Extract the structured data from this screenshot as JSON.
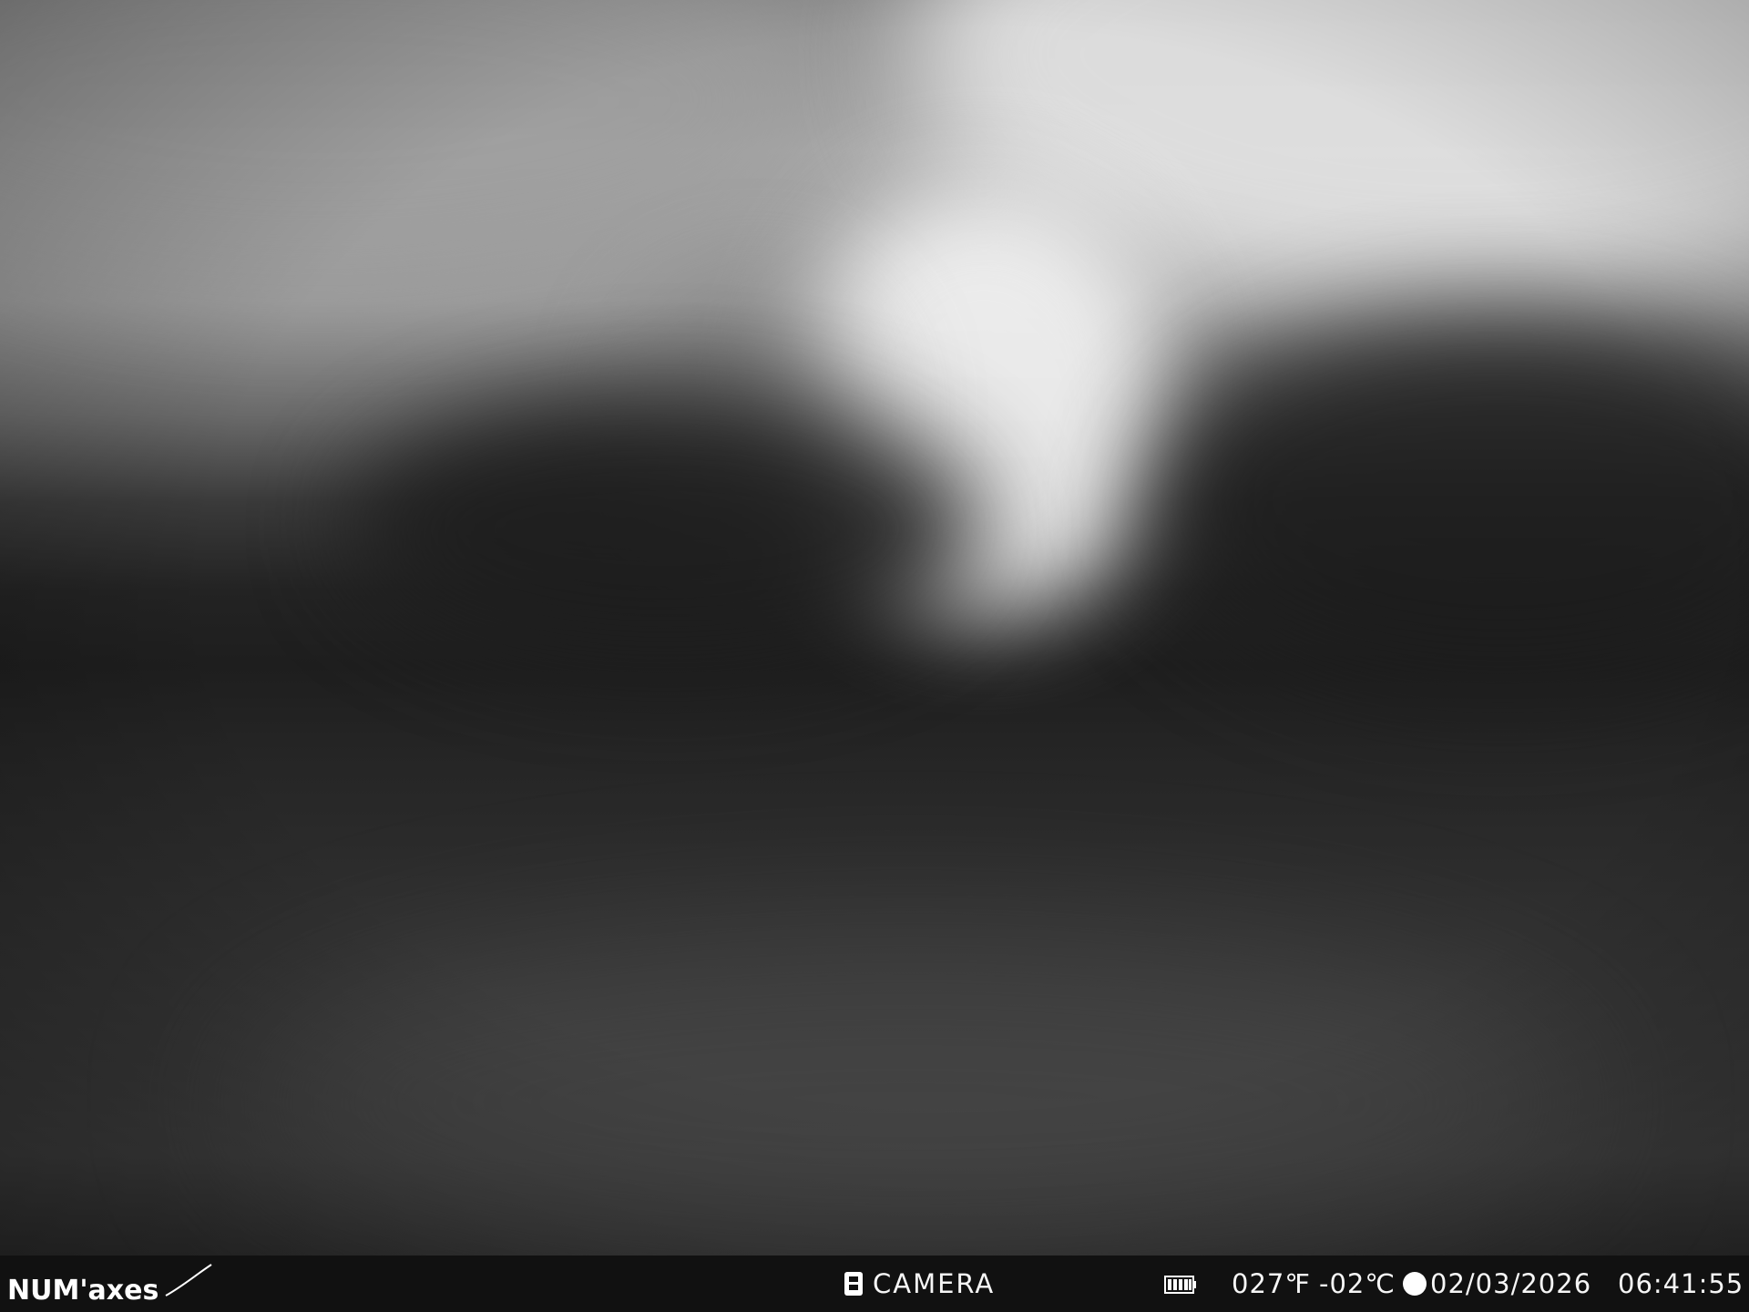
{
  "overlay": {
    "brand": "NUM'axes",
    "mode_label": "CAMERA",
    "mode_icon": "camera-icon",
    "battery_icon": "battery-icon",
    "battery_level": 1.0,
    "temperature_f": "027℉",
    "temperature_c": "-02℃",
    "moon_icon": "full-moon-icon",
    "date": "02/03/2026",
    "time": "06:41:55"
  },
  "colors": {
    "bar_background": "#111111",
    "text": "#f6f6f6"
  }
}
